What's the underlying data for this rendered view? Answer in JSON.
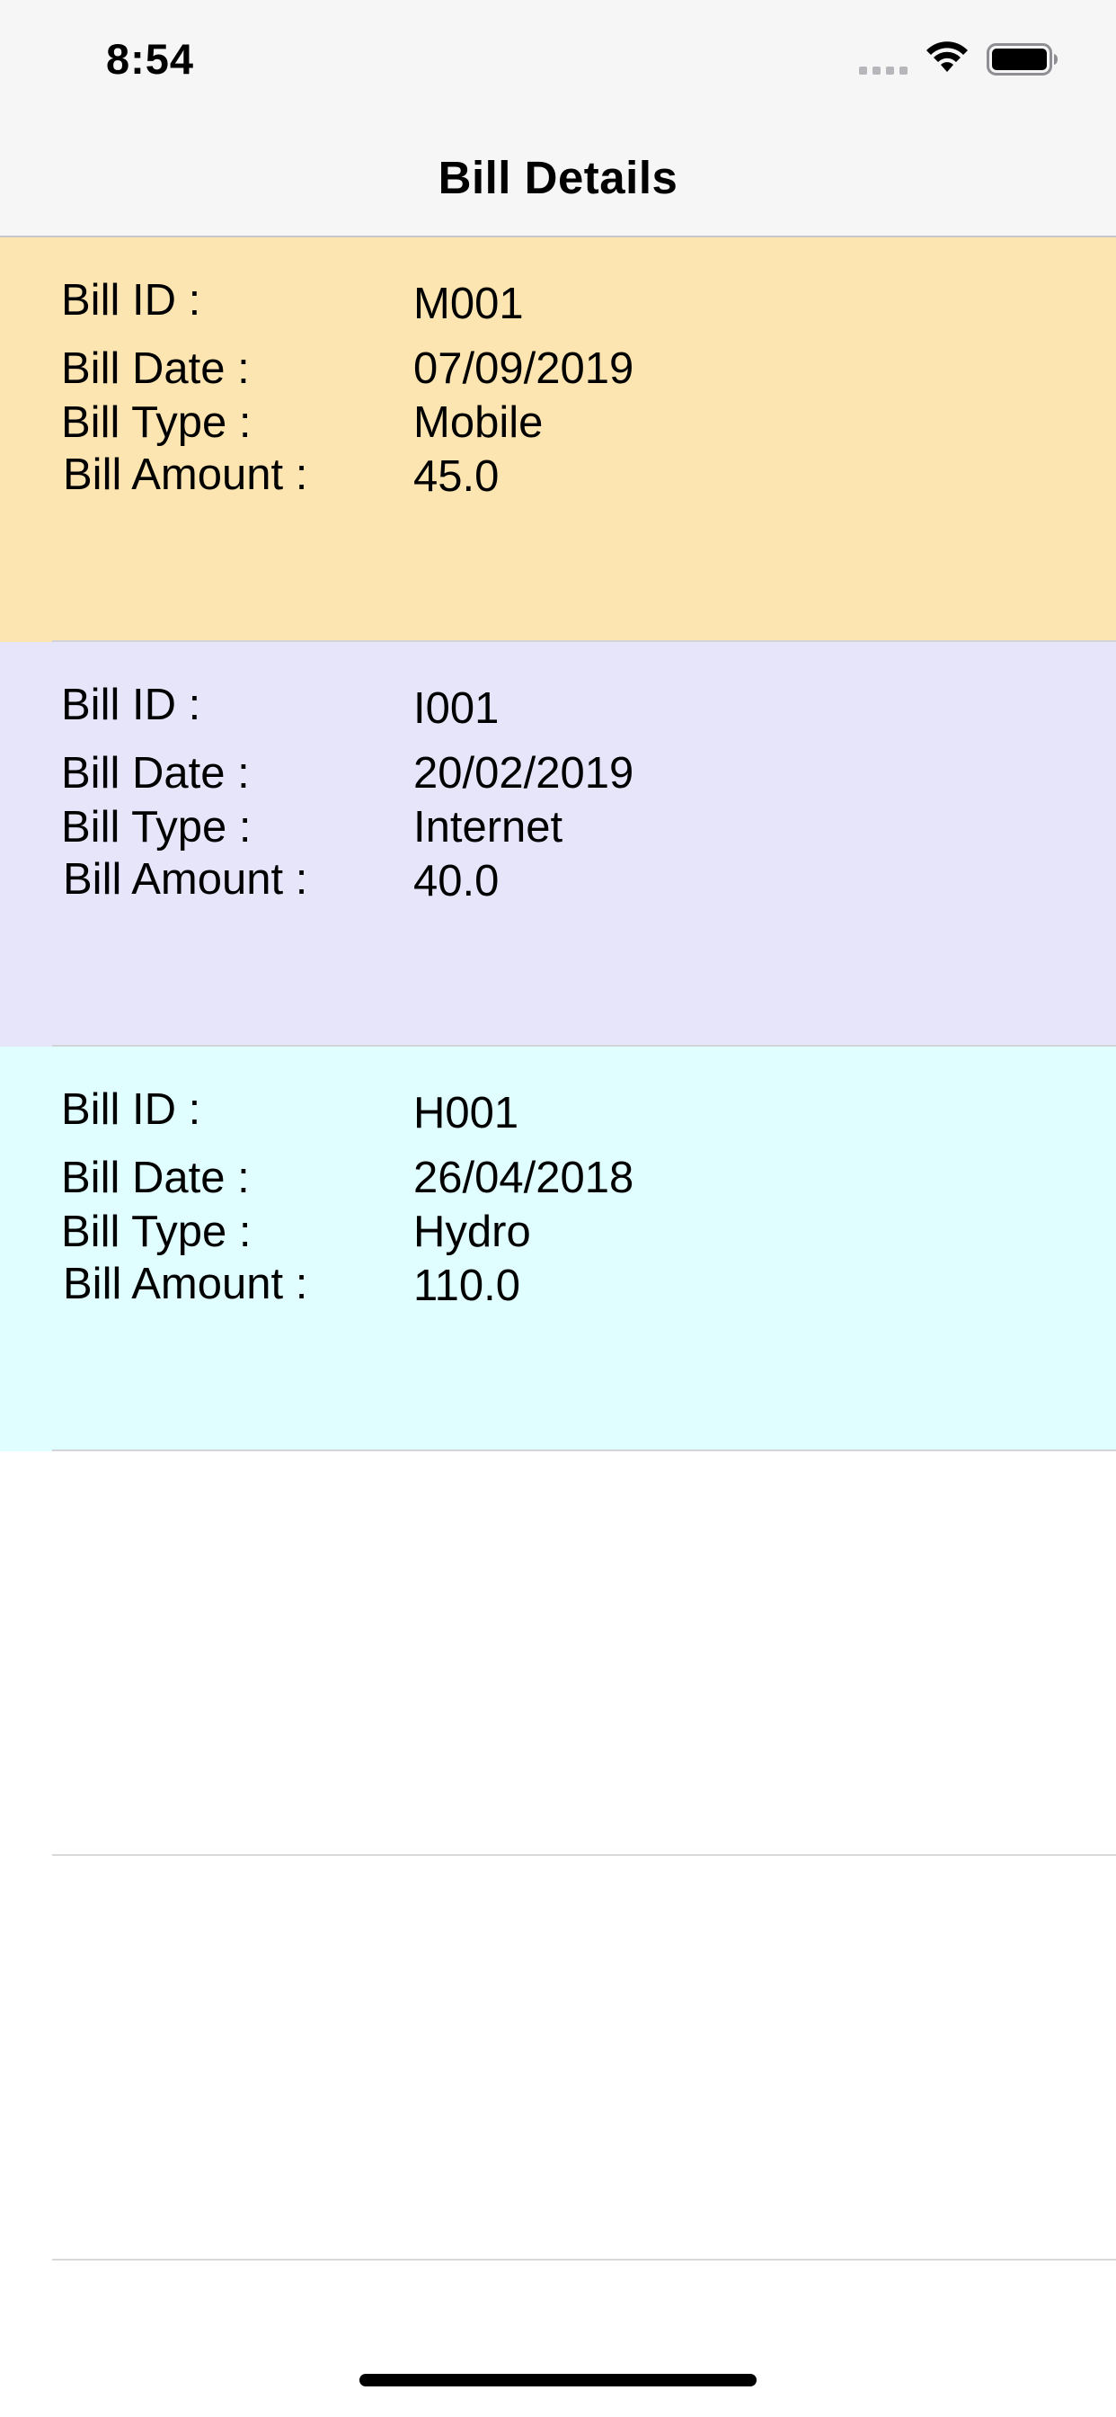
{
  "status_bar": {
    "time": "8:54"
  },
  "nav": {
    "title": "Bill Details"
  },
  "labels": {
    "bill_id": "Bill ID  :",
    "bill_date": "Bill Date :",
    "bill_type": "Bill Type :",
    "bill_amount": "Bill Amount :"
  },
  "bills": [
    {
      "id": "M001",
      "date": "07/09/2019",
      "type": "Mobile",
      "amount": "45.0",
      "background": "#fce5b0"
    },
    {
      "id": "I001",
      "date": "20/02/2019",
      "type": "Internet",
      "amount": "40.0",
      "background": "#e6e5fa"
    },
    {
      "id": "H001",
      "date": "26/04/2018",
      "type": "Hydro",
      "amount": "110.0",
      "background": "#e0feff"
    }
  ],
  "icons": {
    "wifi": "wifi-icon",
    "battery": "battery-icon",
    "signal": "cellular-signal-icon"
  }
}
